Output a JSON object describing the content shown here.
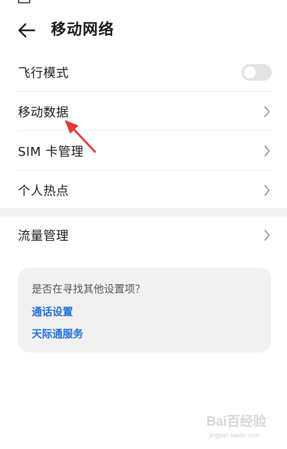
{
  "header": {
    "title": "移动网络",
    "back_icon": "back-arrow-icon"
  },
  "settings": [
    {
      "label": "飞行模式",
      "control": "toggle",
      "toggle_on": false
    },
    {
      "label": "移动数据",
      "control": "chevron"
    },
    {
      "label": "SIM 卡管理",
      "control": "chevron"
    },
    {
      "label": "个人热点",
      "control": "chevron"
    }
  ],
  "settings2": [
    {
      "label": "流量管理",
      "control": "chevron"
    }
  ],
  "suggestion": {
    "question": "是否在寻找其他设置项？",
    "links": [
      "通话设置",
      "天际通服务"
    ]
  },
  "annotation": {
    "arrow_color": "#e03b35",
    "points_to": "移动数据"
  },
  "colors": {
    "link": "#1d6ed8",
    "card_bg": "#f1f1f1",
    "toggle_off": "#e3e3e3"
  },
  "watermark": {
    "logo": "Bai百经验",
    "url": "jingyan.baidu.com"
  }
}
